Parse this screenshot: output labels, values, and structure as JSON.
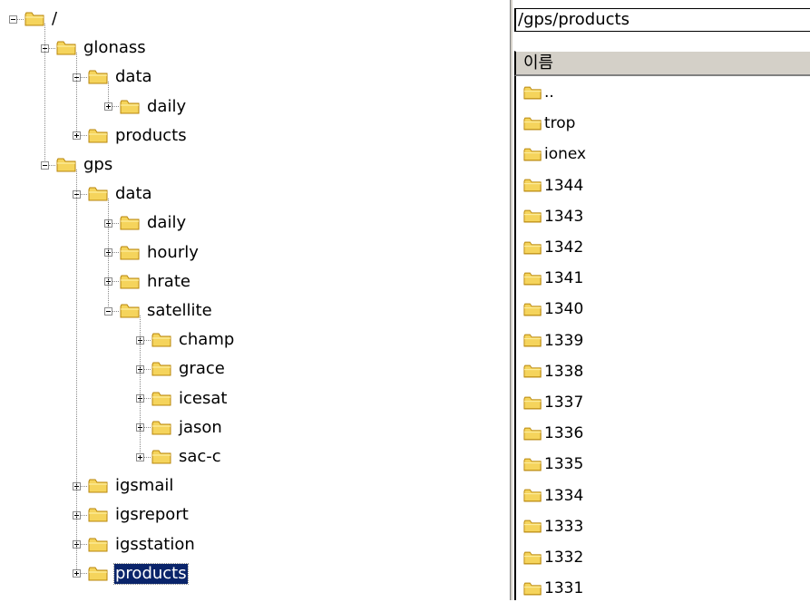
{
  "tree": {
    "nodes": [
      {
        "label": "/",
        "depth": 0,
        "toggle": "minus",
        "name": "tree-node-root"
      },
      {
        "label": "glonass",
        "depth": 1,
        "toggle": "minus",
        "name": "tree-node-glonass"
      },
      {
        "label": "data",
        "depth": 2,
        "toggle": "minus",
        "name": "tree-node-glonass-data"
      },
      {
        "label": "daily",
        "depth": 3,
        "toggle": "plus",
        "name": "tree-node-glonass-daily"
      },
      {
        "label": "products",
        "depth": 2,
        "toggle": "plus",
        "name": "tree-node-glonass-products"
      },
      {
        "label": "gps",
        "depth": 1,
        "toggle": "minus",
        "name": "tree-node-gps"
      },
      {
        "label": "data",
        "depth": 2,
        "toggle": "minus",
        "name": "tree-node-gps-data"
      },
      {
        "label": "daily",
        "depth": 3,
        "toggle": "plus",
        "name": "tree-node-gps-daily"
      },
      {
        "label": "hourly",
        "depth": 3,
        "toggle": "plus",
        "name": "tree-node-gps-hourly"
      },
      {
        "label": "hrate",
        "depth": 3,
        "toggle": "plus",
        "name": "tree-node-gps-hrate"
      },
      {
        "label": "satellite",
        "depth": 3,
        "toggle": "minus",
        "name": "tree-node-gps-satellite"
      },
      {
        "label": "champ",
        "depth": 4,
        "toggle": "plus",
        "name": "tree-node-champ"
      },
      {
        "label": "grace",
        "depth": 4,
        "toggle": "plus",
        "name": "tree-node-grace"
      },
      {
        "label": "icesat",
        "depth": 4,
        "toggle": "plus",
        "name": "tree-node-icesat"
      },
      {
        "label": "jason",
        "depth": 4,
        "toggle": "plus",
        "name": "tree-node-jason"
      },
      {
        "label": "sac-c",
        "depth": 4,
        "toggle": "plus",
        "name": "tree-node-sac-c"
      },
      {
        "label": "igsmail",
        "depth": 2,
        "toggle": "plus",
        "name": "tree-node-igsmail"
      },
      {
        "label": "igsreport",
        "depth": 2,
        "toggle": "plus",
        "name": "tree-node-igsreport"
      },
      {
        "label": "igsstation",
        "depth": 2,
        "toggle": "plus",
        "name": "tree-node-igsstation"
      },
      {
        "label": "products",
        "depth": 2,
        "toggle": "plus",
        "selected": true,
        "name": "tree-node-gps-products"
      }
    ]
  },
  "path": "/gps/products",
  "list_header": "이름",
  "files": [
    "..",
    "trop",
    "ionex",
    "1344",
    "1343",
    "1342",
    "1341",
    "1340",
    "1339",
    "1338",
    "1337",
    "1336",
    "1335",
    "1334",
    "1333",
    "1332",
    "1331"
  ],
  "colors": {
    "folder": "#f5d45c",
    "folder_dark": "#b8860b",
    "selection": "#0a246a"
  }
}
